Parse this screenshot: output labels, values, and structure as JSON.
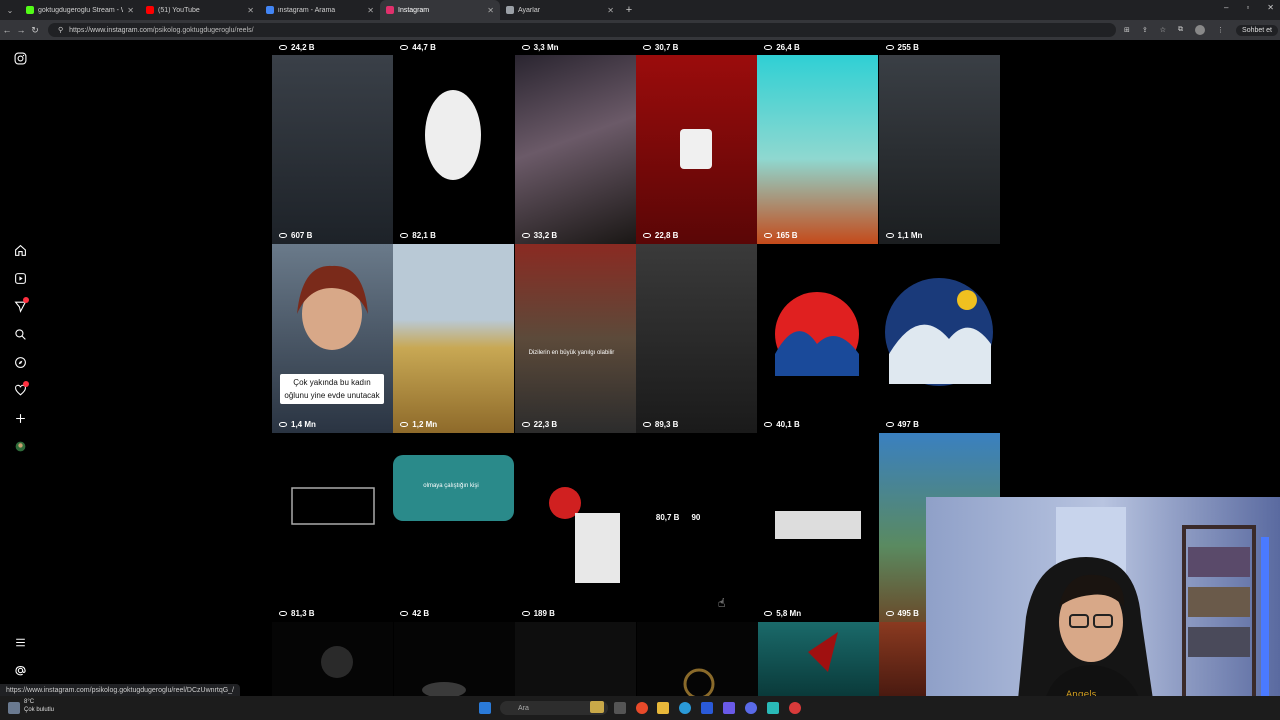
{
  "browser": {
    "tabs": [
      {
        "title": "goktugdugeroglu Stream - Watch",
        "color": "#53fc18",
        "active": false
      },
      {
        "title": "(51) YouTube",
        "color": "#ff0000",
        "active": false
      },
      {
        "title": "instagram - Arama",
        "color": "#4285f4",
        "active": false
      },
      {
        "title": "Instagram",
        "color": "#e1306c",
        "active": true
      },
      {
        "title": "Ayarlar",
        "color": "#9aa0a6",
        "active": false
      }
    ],
    "url_host": "https://www.instagram.com",
    "url_path": "/psikolog.goktugdugeroglu/reels/",
    "profile_button": "Sohbet et",
    "status_url": "https://www.instagram.com/psikolog.goktugdugeroglu/reel/DCzUwnrtqG_/"
  },
  "sidebar": {
    "icons": [
      "instagram-logo-icon",
      "home-icon",
      "reels-icon",
      "messages-icon",
      "search-icon",
      "explore-icon",
      "notifications-icon",
      "create-icon",
      "profile-icon",
      "menu-icon",
      "threads-icon"
    ]
  },
  "reels": {
    "top_row_views": [
      "24,2 B",
      "44,7 B",
      "3,3 Mn",
      "30,7 B",
      "26,4 B",
      "255 B"
    ],
    "rows": [
      [
        {
          "views": "607 B",
          "bg": "linear-gradient(#3a4048,#1d2228)"
        },
        {
          "views": "82,1 B",
          "bg": "#000"
        },
        {
          "views": "33,2 B",
          "bg": "linear-gradient(160deg,#2a2530,#6b5a68 45%,#1a1715)"
        },
        {
          "views": "22,8 B",
          "bg": "linear-gradient(#9b0c0c,#5a0606)"
        },
        {
          "views": "165 B",
          "bg": "linear-gradient(#2fd0d4,#8fd8d0 55%,#c44a1a)"
        },
        {
          "views": "1,1 Mn",
          "bg": "linear-gradient(#3a3f45,#1b1e20)"
        }
      ],
      [
        {
          "views": "1,4 Mn",
          "bg": "linear-gradient(#6a7a8a,#2a3442)",
          "caption": "Çok yakında bu kadın oğlunu yine evde unutacak"
        },
        {
          "views": "1,2 Mn",
          "bg": "linear-gradient(#b9c9d6 40%,#c8a854 55%,#8e6a2a)"
        },
        {
          "views": "22,3 B",
          "bg": "linear-gradient(#8a2a22,#5c4a3a 50%,#2c2c2c)",
          "caption2": "Dizilerin en büyük yanılgı olabilir"
        },
        {
          "views": "89,3 B",
          "bg": "linear-gradient(#3a3a3a,#1a1a1a)"
        },
        {
          "views": "40,1 B",
          "bg": "#000"
        },
        {
          "views": "497 B",
          "bg": "#000"
        }
      ],
      [
        {
          "views": "81,3 B",
          "bg": "#000"
        },
        {
          "views": "42 B",
          "bg": "#000",
          "caption3": "olmaya çalıştığın kişi"
        },
        {
          "views": "189 B",
          "bg": "#000"
        },
        {
          "views": "",
          "bg": "#000",
          "likes": "80,7 B",
          "comments": "90"
        },
        {
          "views": "5,8 Mn",
          "bg": "#000"
        },
        {
          "views": "495 B",
          "bg": "linear-gradient(#3a80c0,#5a8a60 60%,#6a4a2a)"
        }
      ]
    ]
  },
  "taskbar": {
    "weather_temp": "8°C",
    "weather_desc": "Çok bulutlu",
    "search_placeholder": "Ara"
  }
}
